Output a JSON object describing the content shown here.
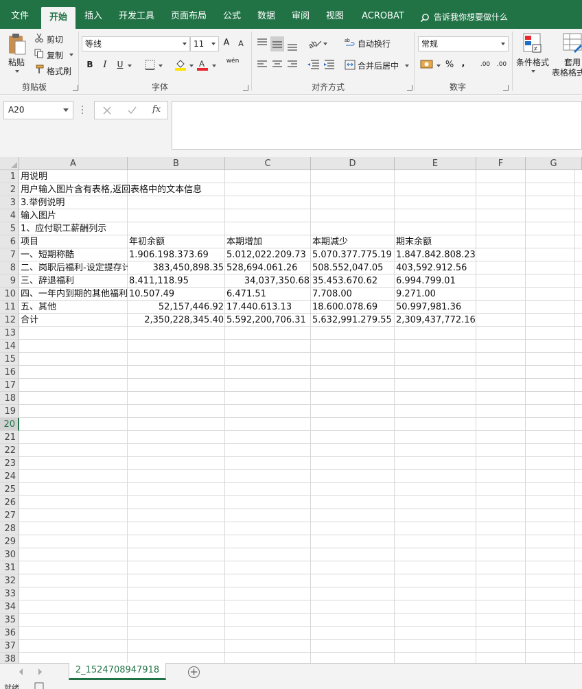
{
  "ribbon_tabs": [
    "文件",
    "开始",
    "插入",
    "开发工具",
    "页面布局",
    "公式",
    "数据",
    "审阅",
    "视图",
    "ACROBAT"
  ],
  "active_tab": "开始",
  "tell_me": "告诉我你想要做什么",
  "clipboard": {
    "paste": "粘贴",
    "cut": "剪切",
    "copy": "复制",
    "format_painter": "格式刷",
    "group_label": "剪贴板"
  },
  "font": {
    "name": "等线",
    "size": "11",
    "bold": "B",
    "italic": "I",
    "underline": "U",
    "grow": "A",
    "shrink": "A",
    "phonetic": "wén",
    "group_label": "字体"
  },
  "alignment": {
    "wrap": "自动换行",
    "merge": "合并后居中",
    "group_label": "对齐方式"
  },
  "number": {
    "format": "常规",
    "percent": "%",
    "comma": ",",
    "inc_dec": ".00",
    "dec_dec": ".00",
    "group_label": "数字"
  },
  "styles": {
    "conditional": "条件格式",
    "table_line1": "套用",
    "table_line2": "表格格式"
  },
  "name_box": "A20",
  "fx_label": "fx",
  "colors": {
    "excel_green": "#217346",
    "font_color": "#e8262d",
    "highlight": "#ffe400"
  },
  "columns": [
    "A",
    "B",
    "C",
    "D",
    "E",
    "F",
    "G"
  ],
  "row_numbers": [
    "1",
    "2",
    "3",
    "4",
    "5",
    "6",
    "7",
    "8",
    "9",
    "10",
    "11",
    "12",
    "13",
    "14",
    "15",
    "16",
    "17",
    "18",
    "19",
    "20",
    "21",
    "22",
    "23",
    "24",
    "25",
    "26",
    "27",
    "28",
    "29",
    "30",
    "31",
    "32",
    "33",
    "34",
    "35",
    "36",
    "37",
    "38"
  ],
  "cells": {
    "r1": "用说明",
    "r2": "用户输入图片含有表格,返回表格中的文本信息",
    "r3": "3.举例说明",
    "r4": "输入图片",
    "r5": "1、应付职工薪酬列示",
    "headers": [
      "项目",
      "年初余额",
      "本期增加",
      "本期减少",
      "期末余额"
    ],
    "rows": [
      [
        "一、短期称酷",
        "1.906.198.373.69",
        "5.012,022.209.73",
        "5.070.377.775.19",
        "1.847.842.808.23"
      ],
      [
        "二、岗职后福利-设定提存计划",
        "383,450,898.35",
        "528,694.061.26",
        "508.552,047.05",
        "403,592.912.56"
      ],
      [
        "三、辞退福利",
        "8.411,118.95",
        "34,037,350.68",
        "35.453.670.62",
        "6.994.799.01"
      ],
      [
        "四、一年内到期的其他福利",
        "10.507.49",
        "6.471.51",
        "7.708.00",
        "9.271.00"
      ],
      [
        "五、其他",
        "52,157,446.92",
        "17.440.613.13",
        "18.600.078.69",
        "50.997,981.36"
      ],
      [
        "合计",
        "2,350,228,345.40",
        "5.592,200,706.31",
        "5.632,991.279.55",
        "2,309,437,772.16"
      ]
    ]
  },
  "sheet_tab": "2_1524708947918",
  "status": "就绪"
}
